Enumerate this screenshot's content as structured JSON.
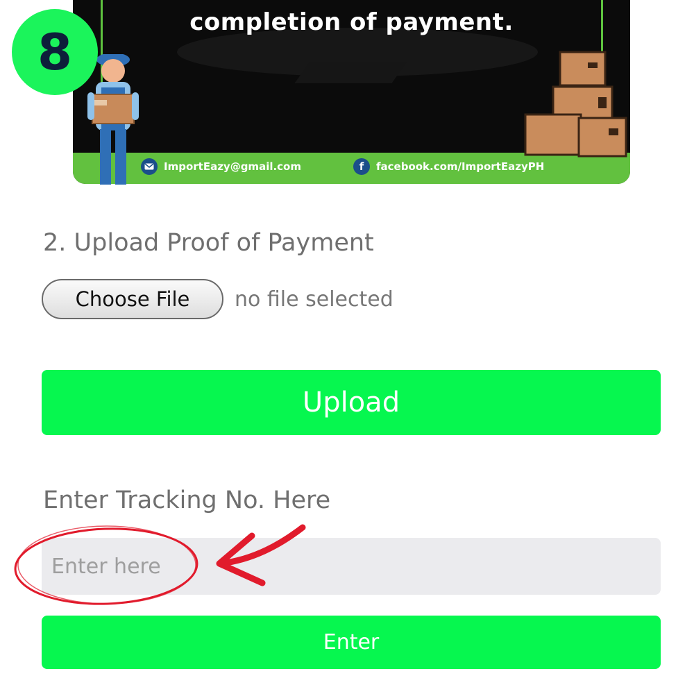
{
  "step_number": "8",
  "banner": {
    "heading": "completion of payment.",
    "email": "ImportEazy@gmail.com",
    "facebook": "facebook.com/ImportEazyPH"
  },
  "upload_section": {
    "label": "2. Upload Proof of Payment",
    "choose_file_label": "Choose File",
    "file_status": "no file selected",
    "upload_button": "Upload"
  },
  "tracking_section": {
    "label": "Enter Tracking No. Here",
    "placeholder": "Enter here",
    "enter_button": "Enter"
  },
  "colors": {
    "accent_green": "#06f74f",
    "badge_green": "#1bf45b",
    "banner_footer": "#62c13f",
    "annotation_red": "#e11b2c"
  },
  "icons": [
    "mail-icon",
    "facebook-icon",
    "arrow-annotation",
    "circle-annotation"
  ]
}
